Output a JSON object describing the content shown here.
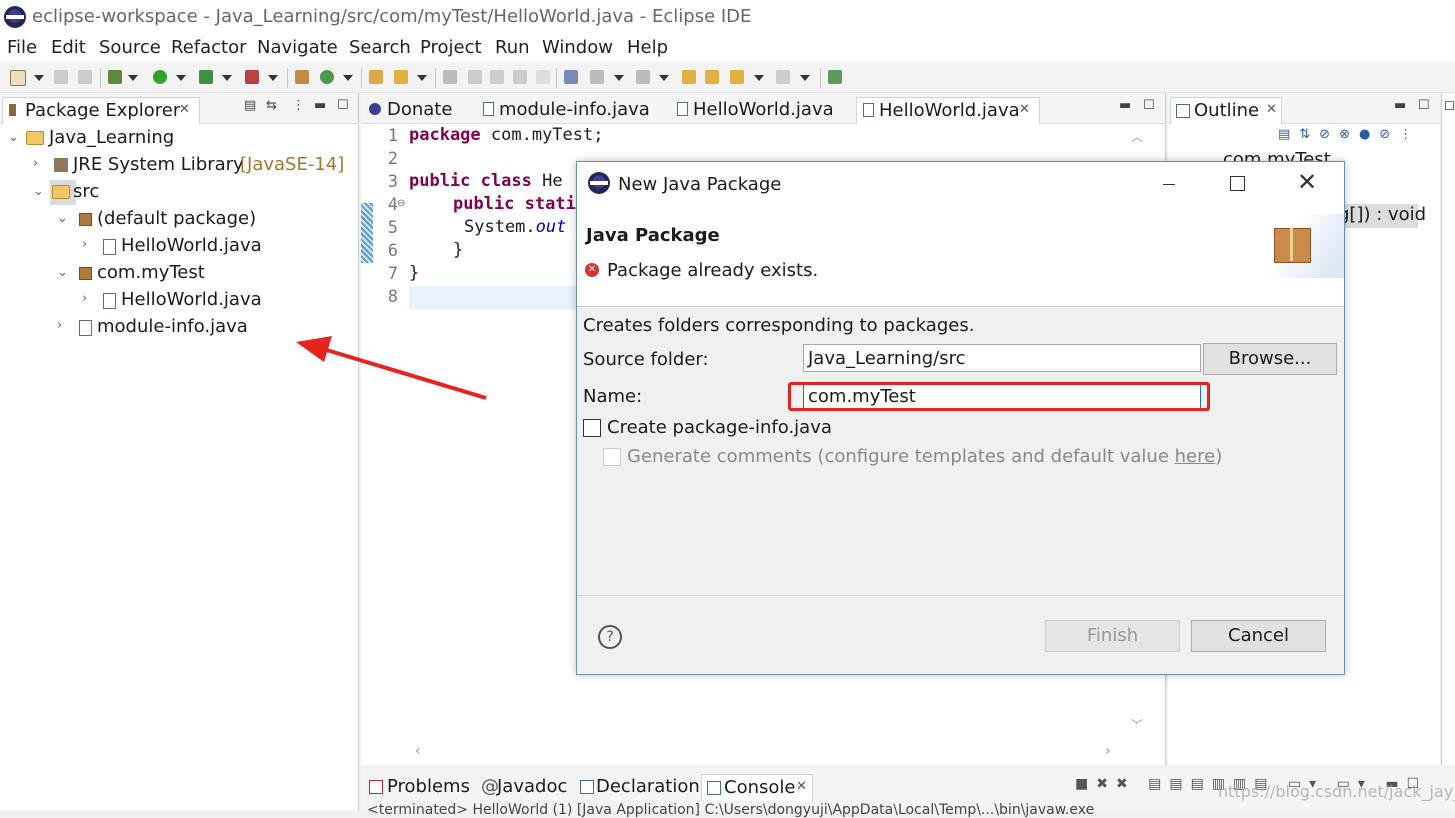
{
  "window": {
    "title": "eclipse-workspace - Java_Learning/src/com/myTest/HelloWorld.java - Eclipse IDE"
  },
  "menu": [
    "File",
    "Edit",
    "Source",
    "Refactor",
    "Navigate",
    "Search",
    "Project",
    "Run",
    "Window",
    "Help"
  ],
  "package_explorer": {
    "tab_label": "Package Explorer",
    "tree": {
      "project": "Java_Learning",
      "jre": "JRE System Library",
      "jre_version": "[JavaSE-14]",
      "src": "src",
      "default_pkg": "(default package)",
      "default_file": "HelloWorld.java",
      "pkg": "com.myTest",
      "pkg_file": "HelloWorld.java",
      "module": "module-info.java"
    }
  },
  "editor": {
    "tabs": [
      "Donate",
      "module-info.java",
      "HelloWorld.java",
      "HelloWorld.java"
    ],
    "line_numbers": [
      "1",
      "2",
      "3",
      "4",
      "5",
      "6",
      "7",
      "8"
    ],
    "code": {
      "l1_kw": "package",
      "l1_rest": " com.myTest;",
      "l3_kw1": "public",
      "l3_kw2": "class",
      "l3_rest": " He",
      "l4_kw1": "public",
      "l4_kw2": "stati",
      "l5_a": "System.",
      "l5_b": "out",
      "l6": "}",
      "l7": "}"
    }
  },
  "outline": {
    "tab_label": "Outline",
    "item1": "com.myTest",
    "item2": "g[]) : void"
  },
  "bottom_panel": {
    "tabs": [
      "Problems",
      "Javadoc",
      "Declaration",
      "Console"
    ],
    "status_line": "<terminated> HelloWorld (1) [Java Application] C:\\Users\\dongyuji\\AppData\\Local\\Temp\\...\\bin\\javaw.exe"
  },
  "dialog": {
    "title": "New Java Package",
    "heading": "Java Package",
    "error": "Package already exists.",
    "description": "Creates folders corresponding to packages.",
    "source_folder_label": "Source folder:",
    "source_folder_value": "Java_Learning/src",
    "browse_label": "Browse...",
    "name_label": "Name:",
    "name_value": "com.myTest",
    "create_info_label": "Create package-info.java",
    "generate_label": "Generate comments",
    "generate_suffix": "(configure templates and default value ",
    "here_link": "here",
    "close_paren": ")",
    "finish_label": "Finish",
    "cancel_label": "Cancel",
    "help_glyph": "?"
  },
  "watermark": "https://blog.csdn.net/jack_jay_du",
  "colors": {
    "keyword": "#7f0055",
    "field": "#0000c0",
    "error_red": "#e8231f",
    "annotation_arrow": "#e8231f"
  }
}
